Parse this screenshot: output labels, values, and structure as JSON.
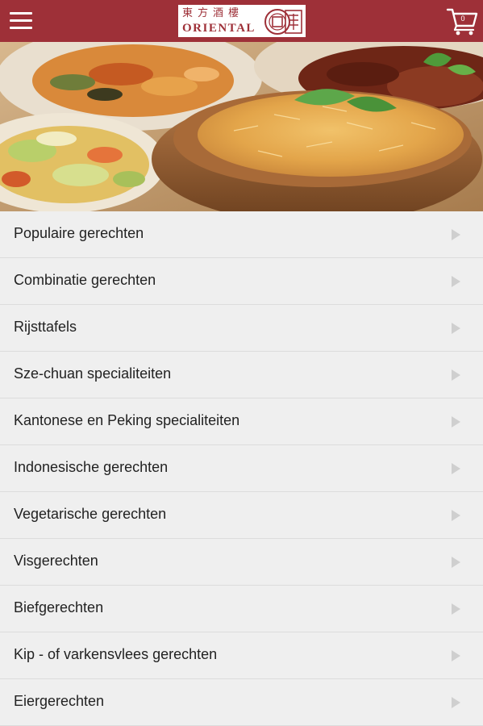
{
  "header": {
    "menu_icon": "hamburger-menu-icon",
    "logo": {
      "chinese": "東方酒樓",
      "latin": "ORIENTAL"
    },
    "cart": {
      "icon": "shopping-cart-icon",
      "count": "0"
    },
    "background_color": "#9e3038"
  },
  "hero": {
    "image": "food-photo: rice in wooden bowl, vegetable dishes, meat"
  },
  "menu": {
    "items": [
      {
        "label": "Populaire gerechten"
      },
      {
        "label": "Combinatie gerechten"
      },
      {
        "label": "Rijsttafels"
      },
      {
        "label": "Sze-chuan specialiteiten"
      },
      {
        "label": "Kantonese en Peking specialiteiten"
      },
      {
        "label": "Indonesische gerechten"
      },
      {
        "label": "Vegetarische gerechten"
      },
      {
        "label": "Visgerechten"
      },
      {
        "label": "Biefgerechten"
      },
      {
        "label": "Kip - of varkensvlees gerechten"
      },
      {
        "label": "Eiergerechten"
      }
    ],
    "arrow_icon": "chevron-right-icon"
  }
}
